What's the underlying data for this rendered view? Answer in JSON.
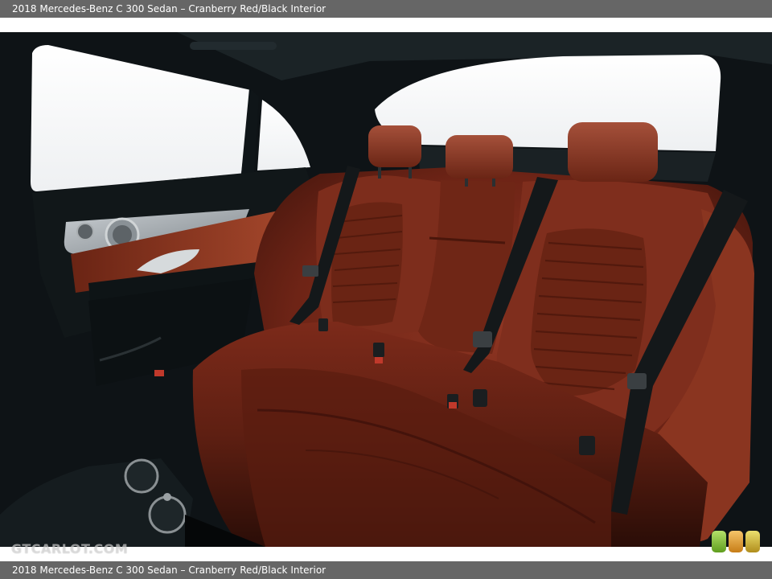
{
  "caption_top": "2018 Mercedes-Benz C 300 Sedan – Cranberry Red/Black Interior",
  "caption_bottom": "2018 Mercedes-Benz C 300 Sedan – Cranberry Red/Black Interior",
  "watermark": "GTCARLOT.COM",
  "badge_colors": [
    "#8cc63f",
    "#e8a33c",
    "#c8b63a"
  ],
  "colors": {
    "caption_bar": "#666666",
    "leather": "#7a2a1c",
    "belt": "#14181a",
    "window": "#fbfbfd"
  }
}
